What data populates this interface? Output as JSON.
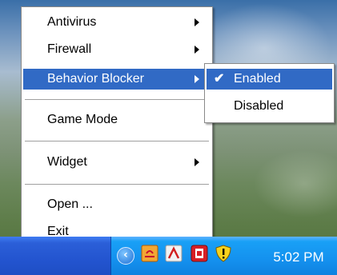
{
  "main_menu": {
    "items": [
      {
        "label": "Antivirus",
        "has_submenu": true,
        "highlighted": false
      },
      {
        "label": "Firewall",
        "has_submenu": true,
        "highlighted": false
      },
      {
        "label": "Behavior Blocker",
        "has_submenu": true,
        "highlighted": true
      },
      {
        "label": "Game Mode",
        "has_submenu": false,
        "highlighted": false
      },
      {
        "label": "Widget",
        "has_submenu": true,
        "highlighted": false
      },
      {
        "label": "Open ...",
        "has_submenu": false,
        "highlighted": false
      },
      {
        "label": "Exit",
        "has_submenu": false,
        "highlighted": false
      }
    ]
  },
  "submenu": {
    "items": [
      {
        "label": "Enabled",
        "checked": true,
        "highlighted": true
      },
      {
        "label": "Disabled",
        "checked": false,
        "highlighted": false
      }
    ],
    "check_glyph": "✔"
  },
  "taskbar": {
    "clock": "5:02 PM",
    "tray_icons": [
      "show-hidden-icons-chevron",
      "security-shield-icon"
    ]
  },
  "colors": {
    "menu_highlight": "#316ac5",
    "taskbar_blue": "#2354cf",
    "tray_blue": "#1490ee"
  }
}
